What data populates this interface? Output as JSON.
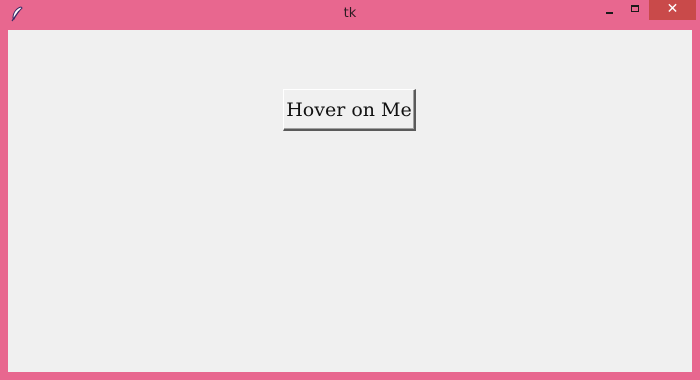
{
  "window": {
    "title": "tk",
    "close_glyph": "✕",
    "accent_color": "#e8678f",
    "close_color": "#c94a4a"
  },
  "icons": {
    "app": "feather-icon",
    "minimize": "minimize-icon",
    "maximize": "maximize-icon",
    "close": "close-icon"
  },
  "main": {
    "button_label": "Hover on Me"
  }
}
